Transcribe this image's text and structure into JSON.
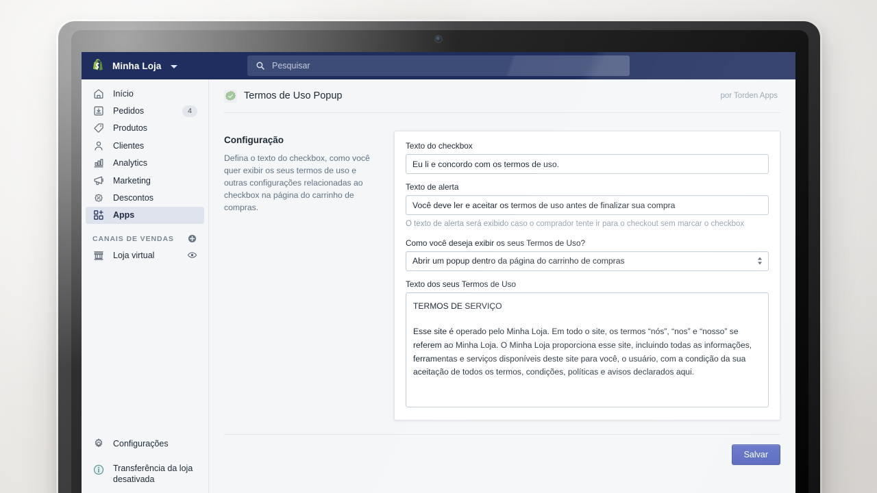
{
  "topbar": {
    "store_name": "Minha Loja",
    "store_menu_icon": "chevron-down-icon",
    "logo_icon": "shopify-bag-icon",
    "search_icon": "search-icon",
    "search_placeholder": "Pesquisar",
    "search_value": "",
    "bg_color": "#1f2e5e",
    "search_bg_color": "#3d4b77"
  },
  "sidebar": {
    "items": [
      {
        "label": "Início",
        "icon": "home-icon",
        "badge": "",
        "active": false
      },
      {
        "label": "Pedidos",
        "icon": "orders-icon",
        "badge": "4",
        "active": false
      },
      {
        "label": "Produtos",
        "icon": "tag-icon",
        "badge": "",
        "active": false
      },
      {
        "label": "Clientes",
        "icon": "person-icon",
        "badge": "",
        "active": false
      },
      {
        "label": "Analytics",
        "icon": "bar-chart-icon",
        "badge": "",
        "active": false
      },
      {
        "label": "Marketing",
        "icon": "megaphone-icon",
        "badge": "",
        "active": false
      },
      {
        "label": "Descontos",
        "icon": "discount-icon",
        "badge": "",
        "active": false
      },
      {
        "label": "Apps",
        "icon": "apps-grid-plus-icon",
        "badge": "",
        "active": true
      }
    ],
    "section_title": "CANAIS DE VENDAS",
    "section_add_icon": "plus-circle-icon",
    "channels": [
      {
        "label": "Loja virtual",
        "icon": "storefront-icon",
        "trailing_icon": "eye-icon"
      }
    ],
    "bottom_items": [
      {
        "label": "Configurações",
        "icon": "gear-icon"
      },
      {
        "label": "Transferência da loja desativada",
        "icon": "info-circle-icon"
      }
    ],
    "active_bg_color": "#dfe3ee"
  },
  "page": {
    "app_icon": "green-seal-check-icon",
    "title": "Termos de Uso Popup",
    "byline": "por Torden Apps"
  },
  "section": {
    "heading": "Configuração",
    "description": "Defina o texto do checkbox, como você quer exibir os seus termos de uso e outras configurações relacionadas ao checkbox na página do carrinho de compras."
  },
  "form": {
    "checkbox_text": {
      "label": "Texto do checkbox",
      "value": "Eu li e concordo com os termos de uso."
    },
    "alert_text": {
      "label": "Texto de alerta",
      "value": "Você deve ler e aceitar os termos de uso antes de finalizar sua compra",
      "help": "O texto de alerta será exibido caso o comprador tente ir para o checkout sem marcar o checkbox"
    },
    "display_mode": {
      "label": "Como você deseja exibir os seus Termos de Uso?",
      "value": "Abrir um popup dentro da página do carrinho de compras",
      "stepper_icon": "stepper-updown-icon"
    },
    "terms_text": {
      "label": "Texto dos seus Termos de Uso",
      "title": "TERMOS DE SERVIÇO",
      "body": "Esse site é operado pelo Minha Loja. Em todo o site, os termos “nós”, “nos” e “nosso” se referem ao Minha Loja. O Minha Loja proporciona esse site, incluindo todas as informações, ferramentas e serviços disponíveis deste site para você, o usuário, com a condição da sua aceitação de todos os termos, condições, políticas e avisos declarados aqui."
    }
  },
  "footer": {
    "save_label": "Salvar",
    "save_color": "#5c6ac4"
  }
}
